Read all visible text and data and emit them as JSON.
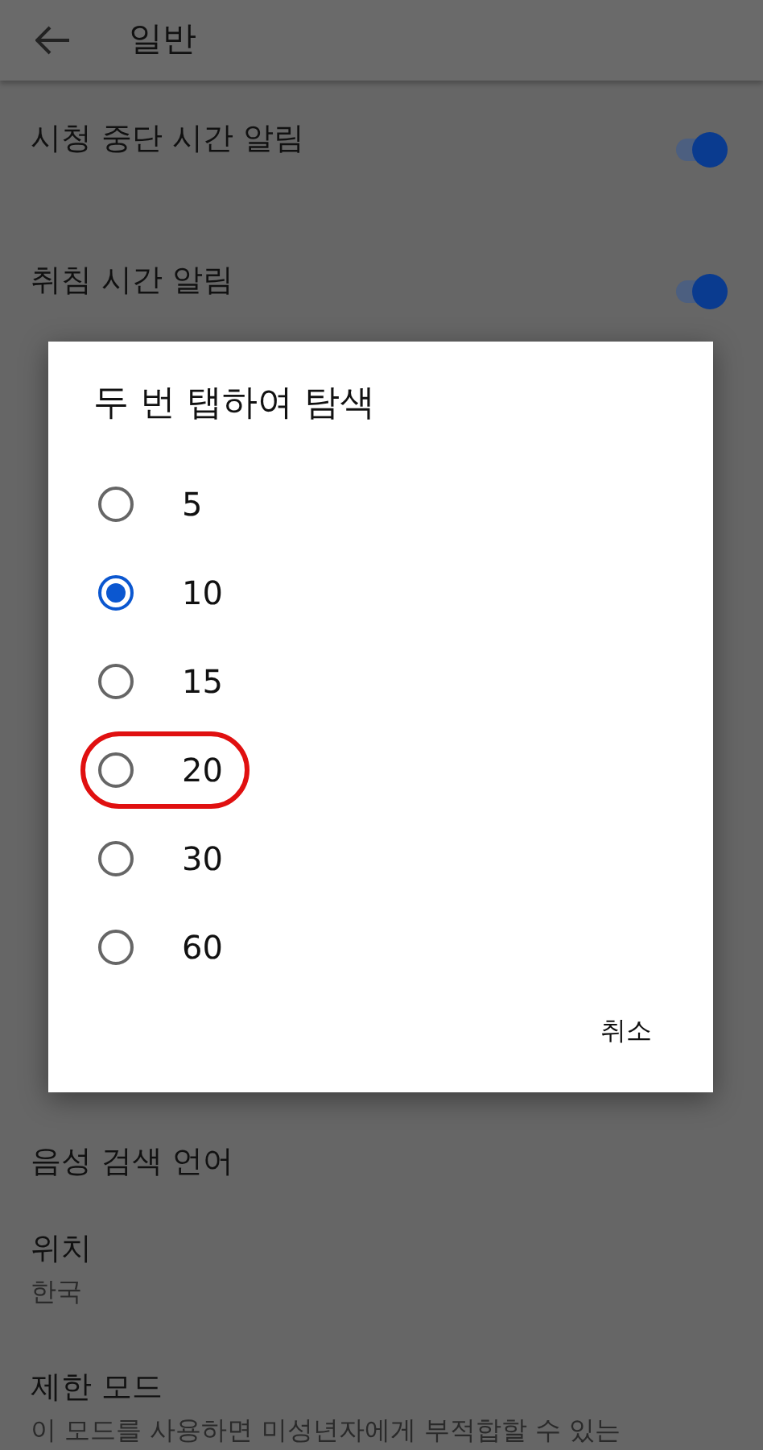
{
  "header": {
    "title": "일반"
  },
  "settings": [
    {
      "kind": "toggle",
      "label": "시청 중단 시간 알림",
      "on": true
    },
    {
      "kind": "toggle",
      "label": "취침 시간 알림",
      "on": true
    }
  ],
  "settings_below": [
    {
      "kind": "plain",
      "label": "음성 검색 언어"
    },
    {
      "kind": "detail",
      "label": "위치",
      "detail": "한국"
    },
    {
      "kind": "detail",
      "label": "제한 모드",
      "detail": "이 모드를 사용하면 미성년자에게 부적합할 수 있는"
    }
  ],
  "dialog": {
    "title": "두 번 탭하여 탐색",
    "options": [
      {
        "label": "5",
        "selected": false,
        "highlighted": false
      },
      {
        "label": "10",
        "selected": true,
        "highlighted": false
      },
      {
        "label": "15",
        "selected": false,
        "highlighted": false
      },
      {
        "label": "20",
        "selected": false,
        "highlighted": true
      },
      {
        "label": "30",
        "selected": false,
        "highlighted": false
      },
      {
        "label": "60",
        "selected": false,
        "highlighted": false
      }
    ],
    "cancel": "취소"
  }
}
